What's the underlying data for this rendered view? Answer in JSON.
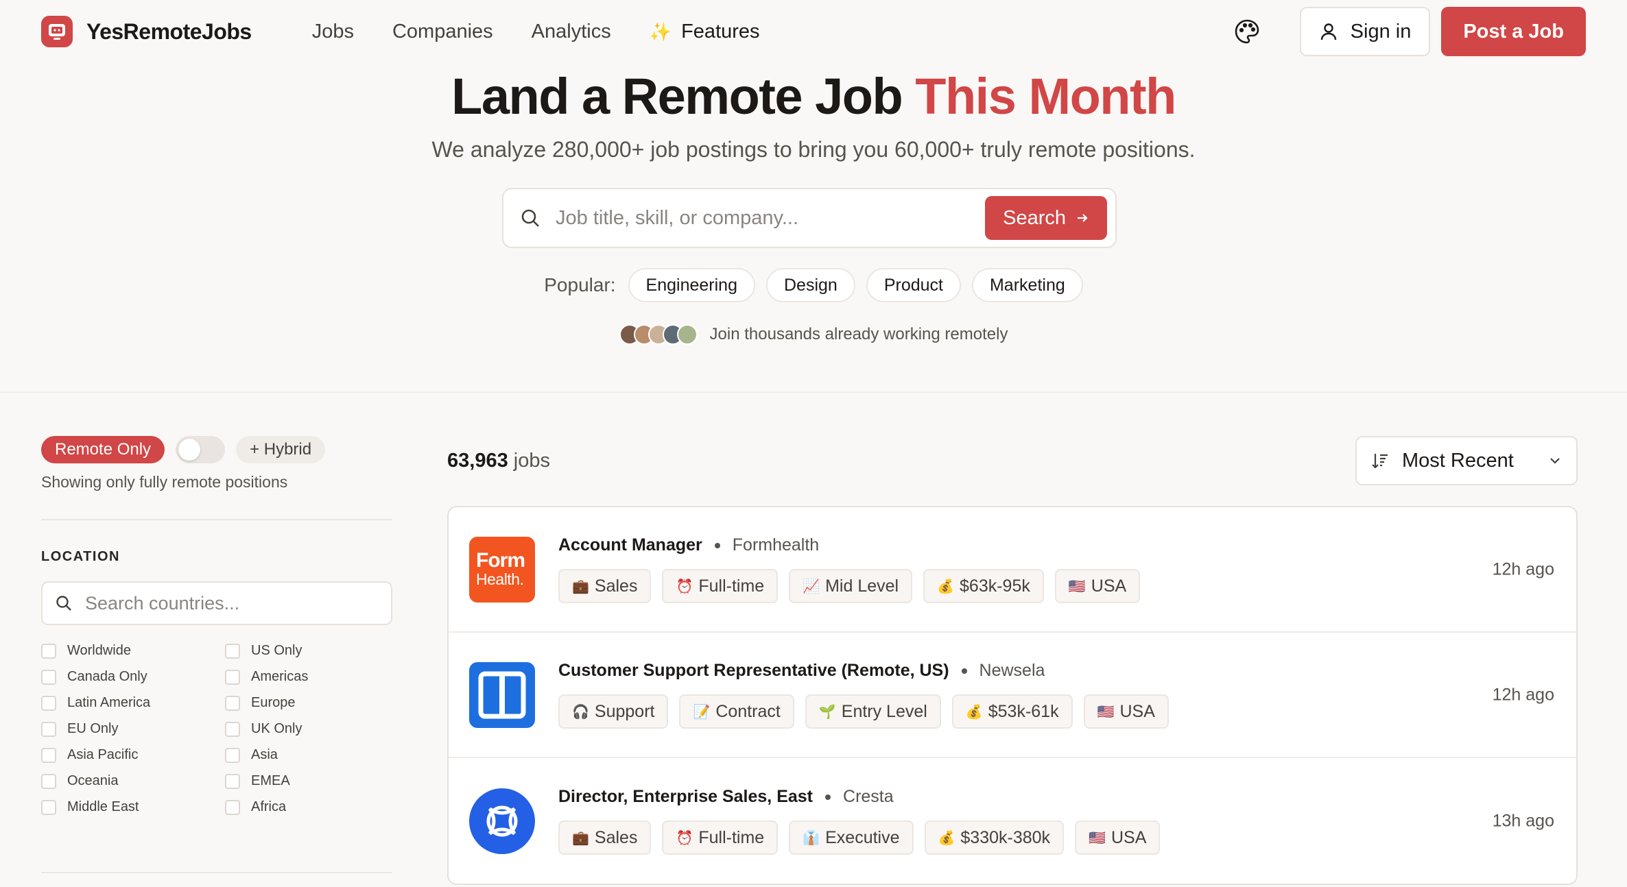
{
  "nav": {
    "brand": "YesRemoteJobs",
    "links": [
      "Jobs",
      "Companies",
      "Analytics"
    ],
    "features_label": "Features",
    "sign_in": "Sign in",
    "post_job": "Post a Job"
  },
  "hero": {
    "headline_main": "Land a Remote Job ",
    "headline_accent": "This Month",
    "subhead": "We analyze 280,000+ job postings to bring you 60,000+ truly remote positions.",
    "search_placeholder": "Job title, skill, or company...",
    "search_button": "Search",
    "popular_label": "Popular:",
    "popular": [
      "Engineering",
      "Design",
      "Product",
      "Marketing"
    ],
    "social_proof": "Join thousands already working remotely"
  },
  "filters": {
    "remote_only": "Remote Only",
    "hybrid": "+ Hybrid",
    "showing": "Showing only fully remote positions",
    "location_title": "LOCATION",
    "country_placeholder": "Search countries...",
    "countries": [
      "Worldwide",
      "US Only",
      "Canada Only",
      "Americas",
      "Latin America",
      "Europe",
      "EU Only",
      "UK Only",
      "Asia Pacific",
      "Asia",
      "Oceania",
      "EMEA",
      "Middle East",
      "Africa"
    ]
  },
  "results": {
    "count": "63,963",
    "count_suffix": " jobs",
    "sort": "Most Recent"
  },
  "jobs": [
    {
      "title": "Account Manager",
      "company": "Formhealth",
      "logo_line1": "Form",
      "logo_line2": "Health.",
      "logo_color": "#f2551f",
      "tags": [
        {
          "emoji": "💼",
          "label": "Sales"
        },
        {
          "emoji": "⏰",
          "label": "Full-time"
        },
        {
          "emoji": "📈",
          "label": "Mid Level"
        },
        {
          "emoji": "💰",
          "label": "$63k-95k"
        },
        {
          "emoji": "🇺🇸",
          "label": "USA"
        }
      ],
      "time": "12h ago"
    },
    {
      "title": "Customer Support Representative (Remote, US)",
      "company": "Newsela",
      "logo_color": "#1d6fe0",
      "tags": [
        {
          "emoji": "🎧",
          "label": "Support"
        },
        {
          "emoji": "📝",
          "label": "Contract"
        },
        {
          "emoji": "🌱",
          "label": "Entry Level"
        },
        {
          "emoji": "💰",
          "label": "$53k-61k"
        },
        {
          "emoji": "🇺🇸",
          "label": "USA"
        }
      ],
      "time": "12h ago"
    },
    {
      "title": "Director, Enterprise Sales, East",
      "company": "Cresta",
      "logo_color": "#2460e6",
      "tags": [
        {
          "emoji": "💼",
          "label": "Sales"
        },
        {
          "emoji": "⏰",
          "label": "Full-time"
        },
        {
          "emoji": "👔",
          "label": "Executive"
        },
        {
          "emoji": "💰",
          "label": "$330k-380k"
        },
        {
          "emoji": "🇺🇸",
          "label": "USA"
        }
      ],
      "time": "13h ago"
    }
  ],
  "colors": {
    "accent": "#d14646",
    "background": "#faf8f6"
  }
}
